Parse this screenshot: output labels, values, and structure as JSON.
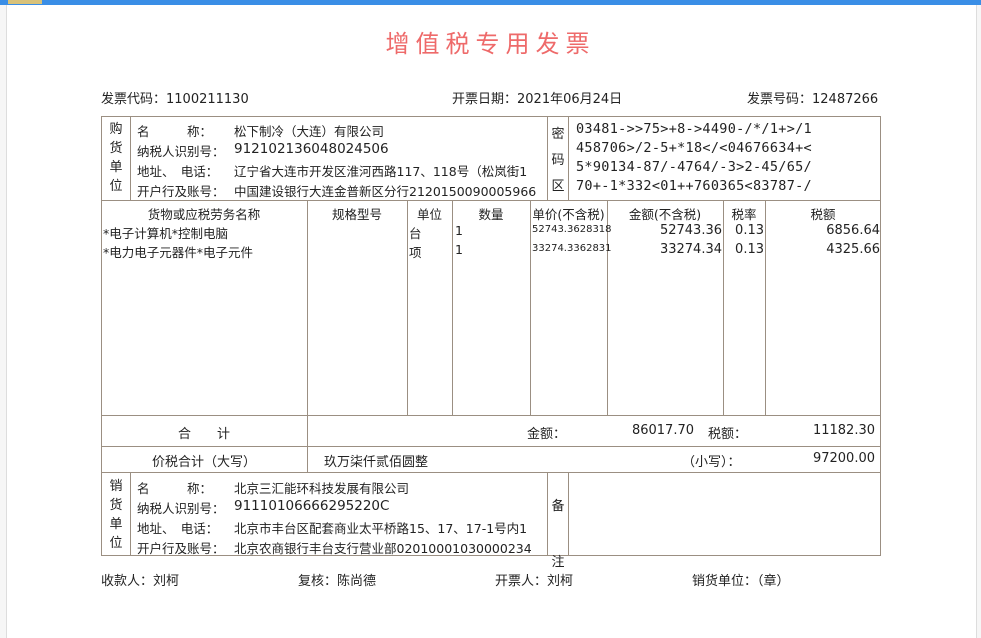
{
  "title": "增值税专用发票",
  "meta": {
    "invoice_code": "发票代码：1100211130",
    "issue_date": "开票日期：2021年06月24日",
    "invoice_number": "发票号码：12487266"
  },
  "buyer": {
    "side_label": [
      "购",
      "货",
      "单",
      "位"
    ],
    "name_label": "名　　　称：",
    "name": "松下制冷（大连）有限公司",
    "taxid_label": "纳税人识别号：",
    "taxid": "912102136048024506",
    "addr_label": "地址、　电话：",
    "addr": "辽宁省大连市开发区淮河西路117、118号（松岚街1",
    "bank_label": "开户行及账号：",
    "bank": "中国建设银行大连金普新区分行2120150090005966"
  },
  "cipher": {
    "side_label": [
      "密",
      "码",
      "区"
    ],
    "lines": [
      "03481->>75>+8->4490-/*/1+>/1",
      "458706>/2-5+*18</<04676634+<",
      "5*90134-87/-4764/-3>2-45/65/",
      "70+-1*332<01++760365<83787-/"
    ]
  },
  "items": {
    "headers": [
      "货物或应税劳务名称",
      "规格型号",
      "单位",
      "数量",
      "单价(不含税)",
      "金额(不含税)",
      "税率",
      "税额"
    ],
    "rows": [
      {
        "name": "*电子计算机*控制电脑",
        "spec": "",
        "unit": "台",
        "qty": "1",
        "price": "52743.3628318",
        "amount": "52743.36",
        "rate": "0.13",
        "tax": "6856.64"
      },
      {
        "name": "*电力电子元器件*电子元件",
        "spec": "",
        "unit": "项",
        "qty": "1",
        "price": "33274.3362831",
        "amount": "33274.34",
        "rate": "0.13",
        "tax": "4325.66"
      }
    ]
  },
  "totals": {
    "label": "合　　计",
    "amount_label": "金额：",
    "amount": "86017.70",
    "tax_label": "税额：",
    "tax": "11182.30"
  },
  "grand": {
    "label": "价税合计（大写）",
    "words": "玖万柒仟贰佰圆整",
    "small_label": "（小写）：",
    "small_value": "97200.00"
  },
  "seller": {
    "side_label": [
      "销",
      "货",
      "单",
      "位"
    ],
    "name_label": "名　　　称：",
    "name": "北京三汇能环科技发展有限公司",
    "taxid_label": "纳税人识别号：",
    "taxid": "91110106666295220C",
    "addr_label": "地址、　电话：",
    "addr": "北京市丰台区配套商业太平桥路15、17、17-1号内1",
    "bank_label": "开户行及账号：",
    "bank": "北京农商银行丰台支行营业部02010001030000234"
  },
  "remarks": {
    "side_label": [
      "备",
      "注"
    ]
  },
  "footer": {
    "payee": "收款人：刘柯",
    "reviewer": "复核：陈尚德",
    "issuer": "开票人：刘柯",
    "seller_unit": "销货单位：（章）"
  }
}
